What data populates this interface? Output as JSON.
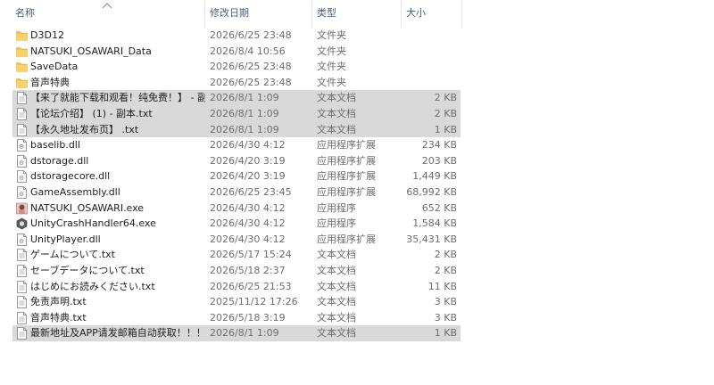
{
  "header": {
    "name": "名称",
    "date": "修改日期",
    "type": "类型",
    "size": "大小"
  },
  "colors": {
    "folder": "#f3c44c",
    "selection": "#d9d9d9"
  },
  "files": [
    {
      "icon": "folder-icon",
      "name": "D3D12",
      "date": "2026/6/25 23:48",
      "type": "文件夹",
      "size": "",
      "selected": false
    },
    {
      "icon": "folder-icon",
      "name": "NATSUKI_OSAWARI_Data",
      "date": "2026/8/4 10:56",
      "type": "文件夹",
      "size": "",
      "selected": false
    },
    {
      "icon": "folder-icon",
      "name": "SaveData",
      "date": "2026/6/25 23:48",
      "type": "文件夹",
      "size": "",
      "selected": false
    },
    {
      "icon": "folder-icon",
      "name": "音声特典",
      "date": "2026/6/25 23:48",
      "type": "文件夹",
      "size": "",
      "selected": false
    },
    {
      "icon": "text-file-icon",
      "name": "【来了就能下载和观看！纯免费！】 - 副...",
      "date": "2026/8/1 1:09",
      "type": "文本文档",
      "size": "2 KB",
      "selected": true
    },
    {
      "icon": "text-file-icon",
      "name": "【论坛介绍】 (1) - 副本.txt",
      "date": "2026/8/1 1:09",
      "type": "文本文档",
      "size": "2 KB",
      "selected": true
    },
    {
      "icon": "text-file-icon",
      "name": "【永久地址发布页】 .txt",
      "date": "2026/8/1 1:09",
      "type": "文本文档",
      "size": "1 KB",
      "selected": true
    },
    {
      "icon": "dll-file-icon",
      "name": "baselib.dll",
      "date": "2026/4/30 4:12",
      "type": "应用程序扩展",
      "size": "234 KB",
      "selected": false
    },
    {
      "icon": "dll-file-icon",
      "name": "dstorage.dll",
      "date": "2026/4/20 3:19",
      "type": "应用程序扩展",
      "size": "203 KB",
      "selected": false
    },
    {
      "icon": "dll-file-icon",
      "name": "dstoragecore.dll",
      "date": "2026/4/20 3:19",
      "type": "应用程序扩展",
      "size": "1,449 KB",
      "selected": false
    },
    {
      "icon": "dll-file-icon",
      "name": "GameAssembly.dll",
      "date": "2026/6/25 23:45",
      "type": "应用程序扩展",
      "size": "68,992 KB",
      "selected": false
    },
    {
      "icon": "game-exe-icon",
      "name": "NATSUKI_OSAWARI.exe",
      "date": "2026/4/30 4:12",
      "type": "应用程序",
      "size": "652 KB",
      "selected": false
    },
    {
      "icon": "unity-exe-icon",
      "name": "UnityCrashHandler64.exe",
      "date": "2026/4/30 4:12",
      "type": "应用程序",
      "size": "1,584 KB",
      "selected": false
    },
    {
      "icon": "dll-file-icon",
      "name": "UnityPlayer.dll",
      "date": "2026/4/30 4:12",
      "type": "应用程序扩展",
      "size": "35,431 KB",
      "selected": false
    },
    {
      "icon": "text-file-icon",
      "name": "ゲームについて.txt",
      "date": "2026/5/17 15:24",
      "type": "文本文档",
      "size": "2 KB",
      "selected": false
    },
    {
      "icon": "text-file-icon",
      "name": "セーブデータについて.txt",
      "date": "2026/5/18 2:37",
      "type": "文本文档",
      "size": "2 KB",
      "selected": false
    },
    {
      "icon": "text-file-icon",
      "name": "はじめにお読みください.txt",
      "date": "2026/6/25 21:53",
      "type": "文本文档",
      "size": "11 KB",
      "selected": false
    },
    {
      "icon": "text-file-icon",
      "name": "免责声明.txt",
      "date": "2025/11/12 17:26",
      "type": "文本文档",
      "size": "3 KB",
      "selected": false
    },
    {
      "icon": "text-file-icon",
      "name": "音声特典.txt",
      "date": "2026/5/18 3:19",
      "type": "文本文档",
      "size": "3 KB",
      "selected": false
    },
    {
      "icon": "text-file-icon",
      "name": "最新地址及APP请发邮箱自动获取！！！...",
      "date": "2026/8/1 1:09",
      "type": "文本文档",
      "size": "1 KB",
      "selected": true
    }
  ]
}
